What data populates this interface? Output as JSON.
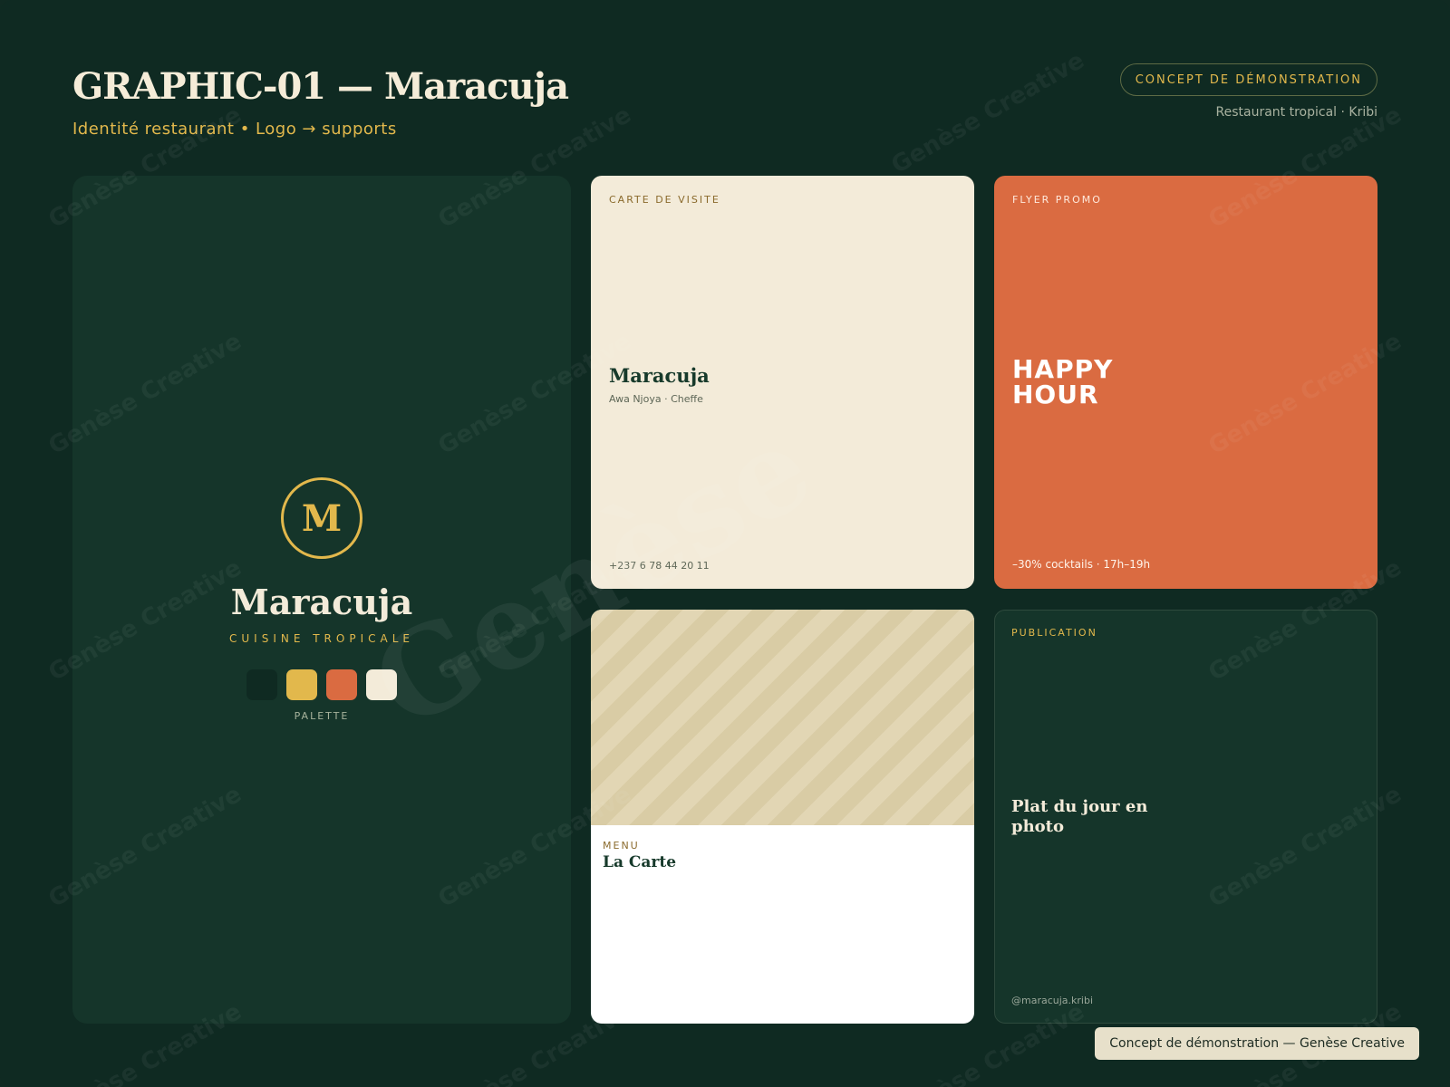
{
  "header": {
    "title": "GRAPHIC-01 — Maracuja",
    "subtitle": "Identité restaurant • Logo → supports",
    "badge": "CONCEPT DE DÉMONSTRATION",
    "location": "Restaurant tropical · Kribi"
  },
  "logo_panel": {
    "monogram": "M",
    "name": "Maracuja",
    "tagline": "CUISINE TROPICALE",
    "palette_label": "PALETTE",
    "palette": [
      "#0f2a22",
      "#e2b84c",
      "#da6b41",
      "#f3ebd9"
    ]
  },
  "business_card": {
    "label": "CARTE DE VISITE",
    "name": "Maracuja",
    "person": "Awa Njoya · Cheffe",
    "phone": "+237 6 78 44 20 11"
  },
  "flyer": {
    "label": "FLYER PROMO",
    "title": "HAPPY HOUR",
    "footer": "–30% cocktails · 17h–19h"
  },
  "menu": {
    "label": "MENU",
    "title": "La Carte"
  },
  "publication": {
    "label": "PUBLICATION",
    "title": "Plat du jour en photo",
    "handle": "@maracuja.kribi"
  },
  "watermark": {
    "text": "Genèse Creative",
    "big_text": "Genèse"
  },
  "footer": {
    "tag": "Concept de démonstration — Genèse Creative"
  }
}
